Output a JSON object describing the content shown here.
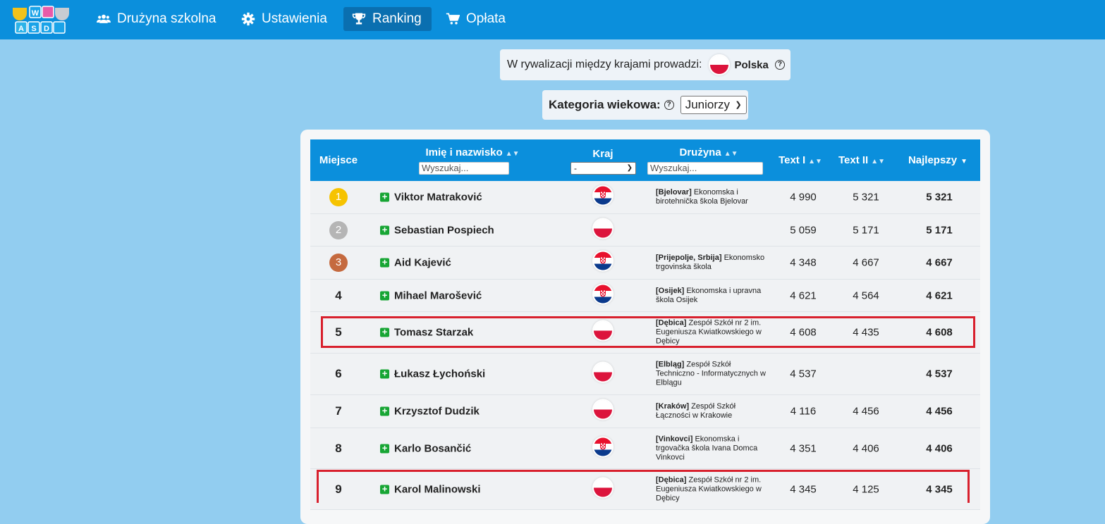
{
  "nav": {
    "items": [
      {
        "label": "Drużyna szkolna",
        "icon": "users-icon"
      },
      {
        "label": "Ustawienia",
        "icon": "gear-icon"
      },
      {
        "label": "Ranking",
        "icon": "trophy-icon",
        "active": true
      },
      {
        "label": "Opłata",
        "icon": "cart-icon"
      }
    ],
    "logo_letters": [
      "W",
      "A",
      "S",
      "D"
    ]
  },
  "leader": {
    "text": "W rywalizacji między krajami prowadzi:",
    "country": "Polska",
    "flag": "pl",
    "help": "?"
  },
  "age": {
    "label": "Kategoria wiekowa:",
    "help": "?",
    "value": "Juniorzy"
  },
  "table": {
    "headers": {
      "place": "Miejsce",
      "name": "Imię i nazwisko",
      "country": "Kraj",
      "team": "Drużyna",
      "text1": "Text I",
      "text2": "Text II",
      "best": "Najlepszy"
    },
    "name_placeholder": "Wyszukaj...",
    "team_placeholder": "Wyszukaj...",
    "country_select": "-",
    "rows": [
      {
        "place": "1",
        "name": "Viktor Matraković",
        "flag": "hr",
        "team_city": "[Bjelovar]",
        "team_name": "Ekonomska i birotehnička škola Bjelovar",
        "text1": "4 990",
        "text2": "5 321",
        "best": "5 321"
      },
      {
        "place": "2",
        "name": "Sebastian Pospiech",
        "flag": "pl",
        "team_city": "",
        "team_name": "",
        "text1": "5 059",
        "text2": "5 171",
        "best": "5 171"
      },
      {
        "place": "3",
        "name": "Aid Kajević",
        "flag": "hr",
        "team_city": "[Prijepolje, Srbija]",
        "team_name": "Ekonomsko trgovinska škola",
        "text1": "4 348",
        "text2": "4 667",
        "best": "4 667"
      },
      {
        "place": "4",
        "name": "Mihael Marošević",
        "flag": "hr",
        "team_city": "[Osijek]",
        "team_name": "Ekonomska i upravna škola Osijek",
        "text1": "4 621",
        "text2": "4 564",
        "best": "4 621"
      },
      {
        "place": "5",
        "name": "Tomasz Starzak",
        "flag": "pl",
        "team_city": "[Dębica]",
        "team_name": "Zespół Szkół nr 2 im. Eugeniusza Kwiatkowskiego w Dębicy",
        "text1": "4 608",
        "text2": "4 435",
        "best": "4 608"
      },
      {
        "place": "6",
        "name": "Łukasz Łychoński",
        "flag": "pl",
        "team_city": "[Elbląg]",
        "team_name": "Zespół Szkół Techniczno - Informatycznych w Elblągu",
        "text1": "4 537",
        "text2": "",
        "best": "4 537"
      },
      {
        "place": "7",
        "name": "Krzysztof Dudzik",
        "flag": "pl",
        "team_city": "[Kraków]",
        "team_name": "Zespół Szkół Łączności w Krakowie",
        "text1": "4 116",
        "text2": "4 456",
        "best": "4 456"
      },
      {
        "place": "8",
        "name": "Karlo Bosančić",
        "flag": "hr",
        "team_city": "[Vinkovci]",
        "team_name": "Ekonomska i trgovačka škola Ivana Domca Vinkovci",
        "text1": "4 351",
        "text2": "4 406",
        "best": "4 406"
      },
      {
        "place": "9",
        "name": "Karol Malinowski",
        "flag": "pl",
        "team_city": "[Dębica]",
        "team_name": "Zespół Szkół nr 2 im. Eugeniusza Kwiatkowskiego w Dębicy",
        "text1": "4 345",
        "text2": "4 125",
        "best": "4 345"
      }
    ]
  },
  "colors": {
    "accent": "#0b8fdc",
    "background": "#92cdf0",
    "highlight": "#d8202d",
    "gold": "#f6c300",
    "silver": "#b5b5b5",
    "bronze": "#c56a3f",
    "plus": "#17a534"
  }
}
